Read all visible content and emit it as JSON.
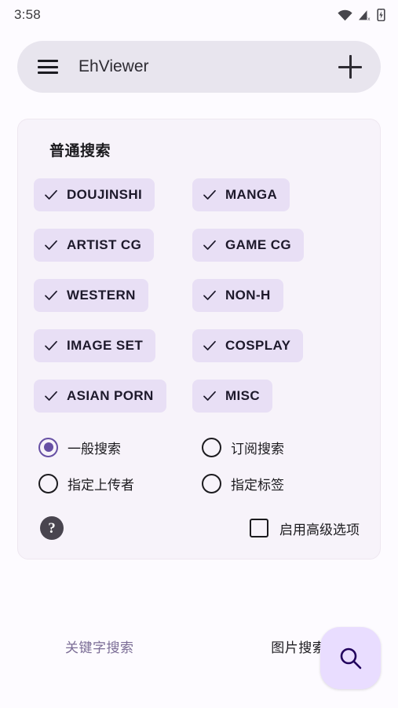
{
  "status_bar": {
    "time": "3:58",
    "icons": [
      "wifi-icon",
      "cellular-signal-off-icon",
      "battery-charging-icon"
    ]
  },
  "appbar": {
    "menu_icon": "hamburger-menu-icon",
    "title": "EhViewer",
    "add_icon": "plus-icon"
  },
  "card": {
    "title": "普通搜索",
    "categories": [
      {
        "label": "DOUJINSHI",
        "checked": true
      },
      {
        "label": "MANGA",
        "checked": true
      },
      {
        "label": "ARTIST CG",
        "checked": true
      },
      {
        "label": "GAME CG",
        "checked": true
      },
      {
        "label": "WESTERN",
        "checked": true
      },
      {
        "label": "NON-H",
        "checked": true
      },
      {
        "label": "IMAGE SET",
        "checked": true
      },
      {
        "label": "COSPLAY",
        "checked": true
      },
      {
        "label": "ASIAN PORN",
        "checked": true
      },
      {
        "label": "MISC",
        "checked": true
      }
    ],
    "search_modes": [
      {
        "label": "一般搜索",
        "selected": true
      },
      {
        "label": "订阅搜索",
        "selected": false
      },
      {
        "label": "指定上传者",
        "selected": false
      },
      {
        "label": "指定标签",
        "selected": false
      }
    ],
    "help_label": "?",
    "advanced": {
      "label": "启用高级选项",
      "checked": false
    }
  },
  "tabs": [
    {
      "label": "关键字搜索",
      "active": true
    },
    {
      "label": "图片搜索",
      "active": false
    }
  ],
  "fab": {
    "icon": "search-icon"
  },
  "colors": {
    "page_bg": "#fdfbff",
    "card_bg": "#f7f3fa",
    "appbar_bg": "#e8e5ee",
    "chip_bg": "#e8dff5",
    "accent": "#6750a4",
    "fab_bg": "#e9ddff",
    "fab_icon": "#21005d",
    "tab_active": "#7b6d96",
    "text": "#1c1b1f"
  }
}
